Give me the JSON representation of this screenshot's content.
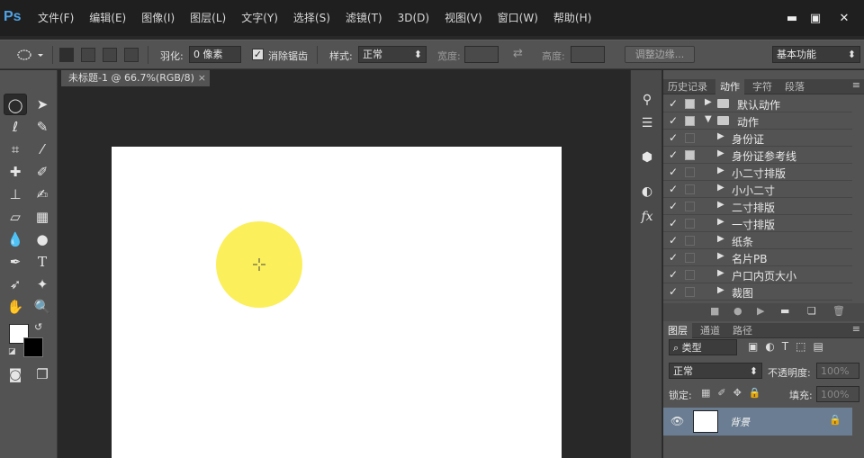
{
  "app": {
    "logo": "Ps"
  },
  "menu": [
    "文件(F)",
    "编辑(E)",
    "图像(I)",
    "图层(L)",
    "文字(Y)",
    "选择(S)",
    "滤镜(T)",
    "3D(D)",
    "视图(V)",
    "窗口(W)",
    "帮助(H)"
  ],
  "window_controls": {
    "minimize": "▬",
    "restore": "▣",
    "close": "✕"
  },
  "options": {
    "feather_label": "羽化:",
    "feather_value": "0 像素",
    "antialias_label": "消除锯齿",
    "antialias_checked": true,
    "style_label": "样式:",
    "style_value": "正常",
    "width_label": "宽度:",
    "height_label": "高度:",
    "refine_edge_label": "调整边缘...",
    "workspace_value": "基本功能"
  },
  "document": {
    "tab_title": "未标题-1 @ 66.7%(RGB/8)",
    "close_glyph": "×"
  },
  "canvas": {
    "background": "#ffffff",
    "circle_color": "#fbef5c"
  },
  "panels": {
    "top_tabs": [
      "历史记录",
      "动作",
      "字符",
      "段落"
    ],
    "active_top_tab": "动作",
    "actions": [
      {
        "label": "默认动作",
        "type": "set",
        "expanded": false,
        "dialog": true
      },
      {
        "label": "动作",
        "type": "set",
        "expanded": true,
        "dialog": true
      },
      {
        "label": "身份证",
        "type": "action",
        "dialog": false
      },
      {
        "label": "身份证参考线",
        "type": "action",
        "dialog": true
      },
      {
        "label": "小二寸排版",
        "type": "action",
        "dialog": false
      },
      {
        "label": "小小二寸",
        "type": "action",
        "dialog": false
      },
      {
        "label": "二寸排版",
        "type": "action",
        "dialog": false
      },
      {
        "label": "一寸排版",
        "type": "action",
        "dialog": false
      },
      {
        "label": "纸条",
        "type": "action",
        "dialog": false
      },
      {
        "label": "名片PB",
        "type": "action",
        "dialog": false
      },
      {
        "label": "户口内页大小",
        "type": "action",
        "dialog": false
      },
      {
        "label": "裁图",
        "type": "action",
        "dialog": false
      }
    ],
    "layer_tabs": [
      "图层",
      "通道",
      "路径"
    ],
    "active_layer_tab": "图层",
    "filter_type": "类型",
    "blend_mode": "正常",
    "opacity_label": "不透明度:",
    "opacity_value": "100%",
    "lock_label": "锁定:",
    "fill_label": "填充:",
    "fill_value": "100%",
    "layer_name": "背景"
  }
}
